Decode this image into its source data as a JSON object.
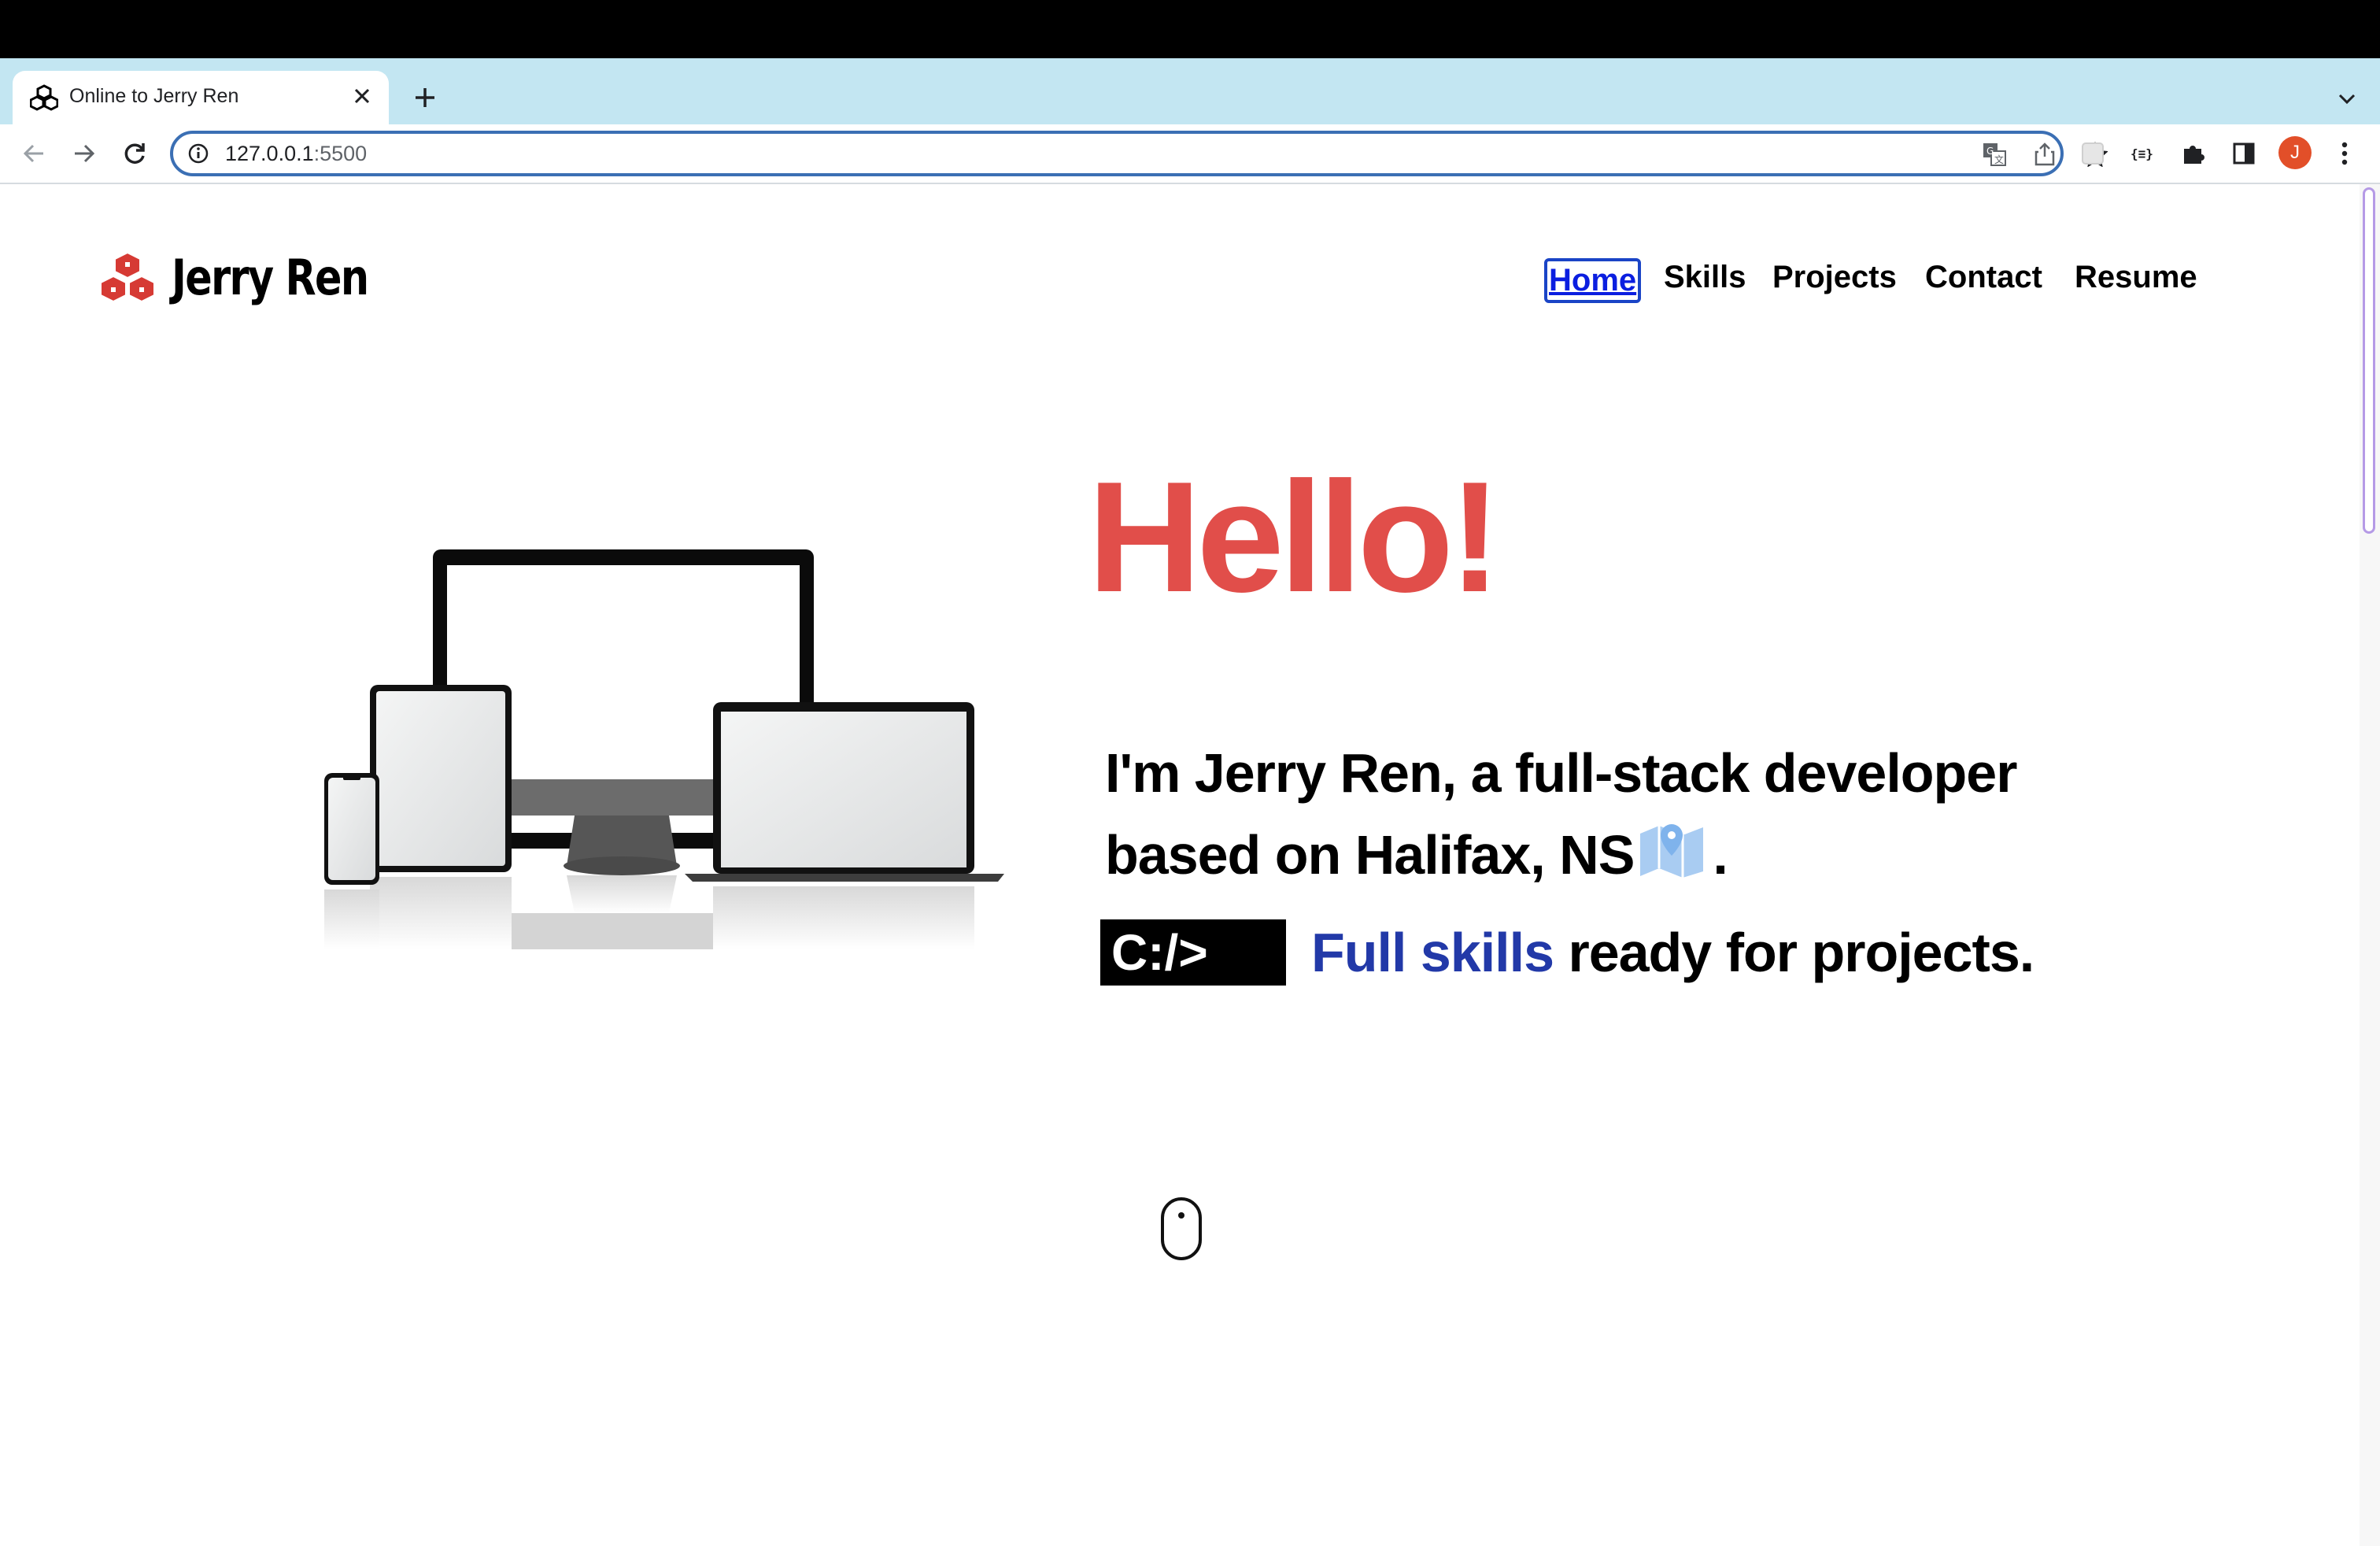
{
  "browser": {
    "tab_title": "Online to Jerry Ren",
    "url_host": "127.0.0.1",
    "url_port": ":5500",
    "profile_initial": "J",
    "colors": {
      "tab_strip": "#c3e6f2",
      "omnibox_border": "#3b6fb4",
      "avatar": "#e24f29"
    }
  },
  "site": {
    "logo_text": "Jerry Ren",
    "logo_icon": "cubes-icon",
    "nav": [
      {
        "label": "Home",
        "active": true
      },
      {
        "label": "Skills",
        "active": false
      },
      {
        "label": "Projects",
        "active": false
      },
      {
        "label": "Contact",
        "active": false
      },
      {
        "label": "Resume",
        "active": false
      }
    ],
    "hero": {
      "greeting": "Hello!",
      "intro_line1": "I'm Jerry Ren, a full-stack developer",
      "intro_line2": "based on Halifax, NS",
      "intro_end": ".",
      "terminal_text": "C:/>",
      "skills_highlight": "Full skills",
      "skills_rest": " ready for projects."
    },
    "colors": {
      "greeting": "#e14e4a",
      "highlight": "#2239a8",
      "logo": "#d63a34"
    }
  }
}
